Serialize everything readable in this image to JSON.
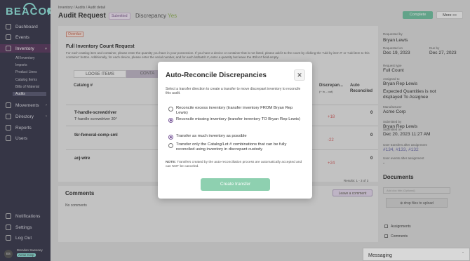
{
  "sidebar": {
    "logo": "BEACON",
    "items": [
      {
        "label": "Dashboard"
      },
      {
        "label": "Events"
      },
      {
        "label": "Inventory"
      },
      {
        "label": "Movements"
      },
      {
        "label": "Directory"
      },
      {
        "label": "Reports"
      },
      {
        "label": "Users"
      }
    ],
    "inventory_sub": [
      "All Inventory",
      "Imports",
      "Product Lines",
      "Catalog Items",
      "Bills of Material",
      "Audits"
    ],
    "bottom": [
      {
        "label": "Notifications"
      },
      {
        "label": "Settings"
      },
      {
        "label": "Log Out"
      }
    ],
    "user": {
      "initials": "BS",
      "name": "Brendan Sweeney",
      "org": "Acme Corp"
    }
  },
  "header": {
    "breadcrumb": "Inventory  /  Audits  /  Audit detail",
    "title": "Audit Request",
    "status_badge": "Submitted",
    "discrepancy_label": "Discrepancy",
    "discrepancy_value": "Yes",
    "complete_label": "Complete",
    "more_label": "More  •••"
  },
  "panel": {
    "overdue": "Overdue",
    "title": "Full Inventory Count Request",
    "description": "For each catalog item and container, please enter the quantity you have in your possession. If you have a device or container that is not listed, please add it to the count by clicking the 'Add by item #' or 'Add item to this container' button. Additionally, for each device, please enter the serial number, and for each lot/batch #, enter a quantity but leave the ID/lot # field empty.",
    "tabs": [
      "LOOSE ITEMS",
      "CONTA"
    ],
    "columns": {
      "catalog": "Catalog #",
      "discrepancy": "Discrepan...",
      "discrepancy_sub": "(+ in, - out)",
      "auto": "Auto",
      "auto2": "Reconciled"
    },
    "rows": [
      {
        "catalog": "T-handle-screwdriver",
        "sub": "T-handle screwdriver 30°",
        "discrepancy": "+18",
        "reconciled": "0"
      },
      {
        "catalog": "tkr-femoral-comp-sml",
        "sub": "",
        "discrepancy": "-22",
        "reconciled": "0"
      },
      {
        "catalog": "acj-wire",
        "sub": "",
        "discrepancy": "+24",
        "reconciled": "0"
      }
    ],
    "results": "Results: 1 - 3 of 3"
  },
  "comments": {
    "title": "Comments",
    "leave_label": "Leave a comment",
    "empty": "No comments"
  },
  "rail": {
    "requested_by_label": "Requested by",
    "requested_by": "Bryan Lewis",
    "requested_on_label": "Requested on",
    "requested_on": "Dec 19, 2023",
    "due_by_label": "Due by",
    "due_by": "Dec 27, 2023",
    "type_label": "Request type",
    "type": "Full Count",
    "assigned_label": "Assigned to",
    "assigned": "Bryan Rep Lewis",
    "expected_label": "Expected Quantities is not displayed To Assignee",
    "manufacturer_label": "Manufacturer",
    "manufacturer": "Acme Corp",
    "submitted_by_label": "Submitted by",
    "submitted_by": "Bryan Rep Lewis",
    "submitted_on_label": "Submitted on",
    "submitted_on": "Dec 20, 2023 11:27 AM",
    "transfers_label": "User transfers after assignment",
    "transfers": "#134, #133, #132",
    "events_label": "User events after assignment",
    "events": "-",
    "documents_title": "Documents",
    "doc_placeholder": "Add doc title (Optional)",
    "drop_label": "drop files to upload",
    "assignments": "Assignments",
    "comments_link": "Comments"
  },
  "messaging": {
    "label": "Messaging"
  },
  "modal": {
    "title": "Auto-Reconcile Discrepancies",
    "description": "Select a transfer direction to create a transfer to move discrepant inventory to reconcile this audit.",
    "direction_options": [
      {
        "label": "Reconcile excess inventory (transfer inventory FROM Bryan Rep Lewis)",
        "selected": false
      },
      {
        "label": "Reconcile missing inventory (transfer inventory TO Bryan Rep Lewis)",
        "selected": true
      }
    ],
    "amount_options": [
      {
        "label": "Transfer as much inventory as possible",
        "selected": true
      },
      {
        "label": "Transfer only the Catalog/Lot # combinations that can be fully reconciled using inventory in discrepant custody",
        "selected": false
      }
    ],
    "note_label": "NOTE:",
    "note": "Transfers created by the auto-reconciliation process are automatically accepted and can NOT be canceled.",
    "create_label": "Create transfer"
  }
}
